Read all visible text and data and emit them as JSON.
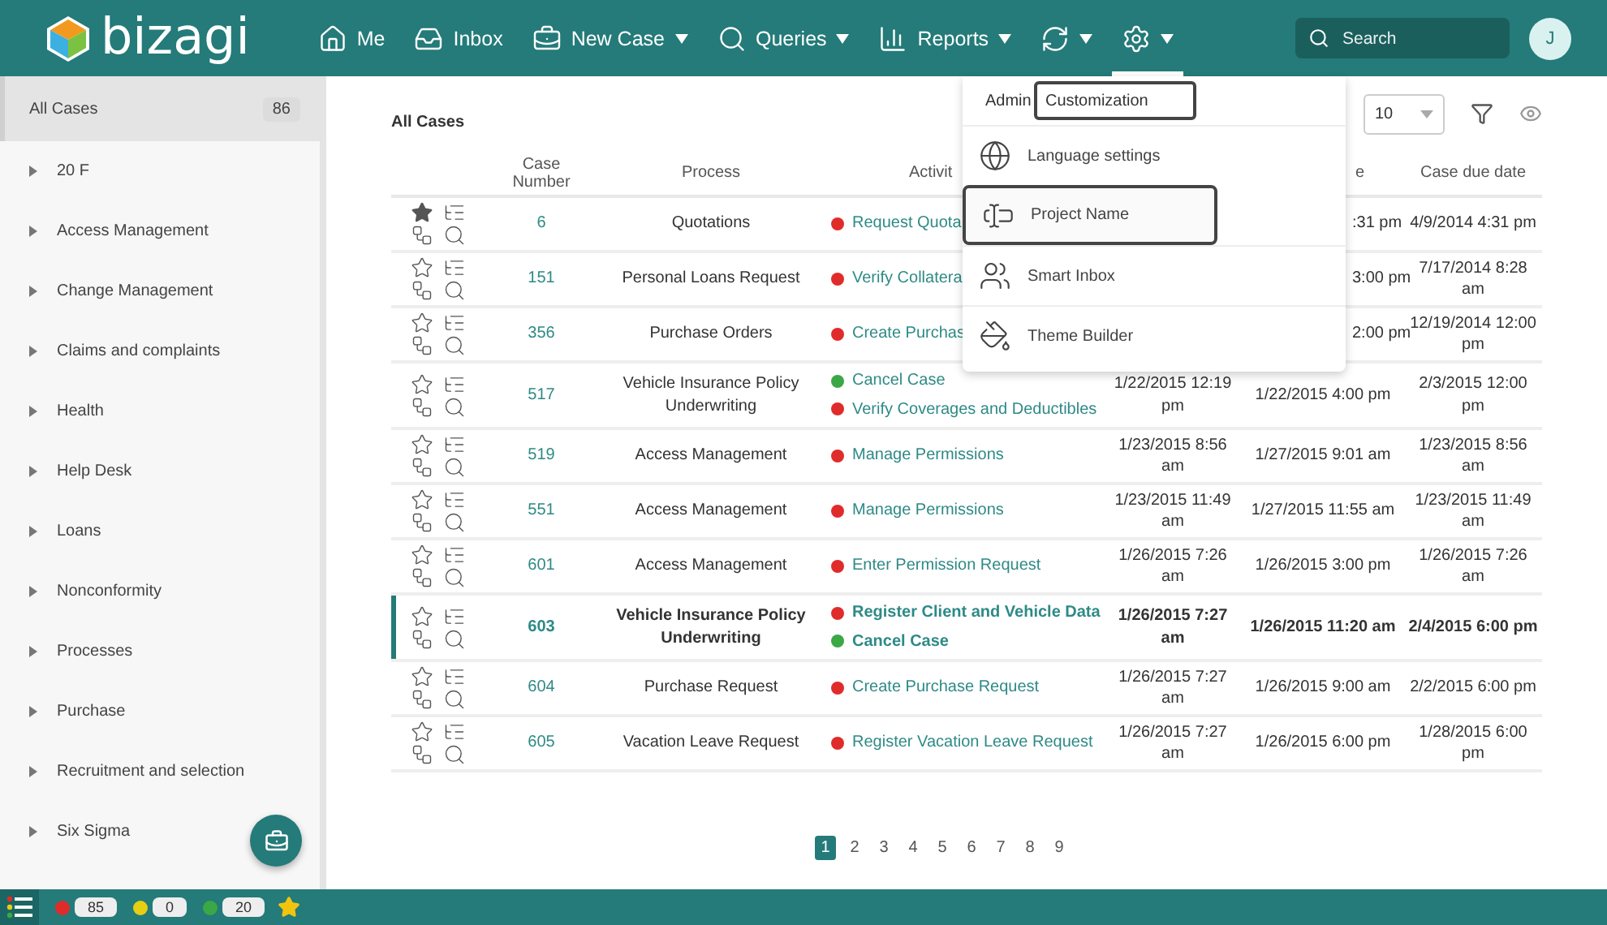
{
  "header": {
    "logo": "bizagi",
    "nav": [
      {
        "label": "Me",
        "dropdown": false,
        "selected": false
      },
      {
        "label": "Inbox",
        "dropdown": false,
        "selected": false
      },
      {
        "label": "New Case",
        "dropdown": true,
        "selected": false
      },
      {
        "label": "Queries",
        "dropdown": true,
        "selected": false
      },
      {
        "label": "Reports",
        "dropdown": true,
        "selected": false
      },
      {
        "dropdown": true,
        "selected": false
      },
      {
        "dropdown": true,
        "selected": true
      }
    ],
    "search": {
      "placeholder": "Search"
    },
    "avatar": "J"
  },
  "sidebar": {
    "items": [
      {
        "label": "All Cases",
        "count": "86",
        "selected": true
      },
      {
        "label": "20 F",
        "selected": false
      },
      {
        "label": "Access Management",
        "selected": false
      },
      {
        "label": "Change Management",
        "selected": false
      },
      {
        "label": "Claims and complaints",
        "selected": false
      },
      {
        "label": "Health",
        "selected": false
      },
      {
        "label": "Help Desk",
        "selected": false
      },
      {
        "label": "Loans",
        "selected": false
      },
      {
        "label": "Nonconformity",
        "selected": false
      },
      {
        "label": "Processes",
        "selected": false
      },
      {
        "label": "Purchase",
        "selected": false
      },
      {
        "label": "Recruitment and selection",
        "selected": false
      },
      {
        "label": "Six Sigma",
        "selected": false
      }
    ]
  },
  "content": {
    "title": "All Cases",
    "per_page": "10",
    "table": {
      "columns": [
        "",
        "Case Number",
        "Process",
        "Activit",
        "",
        "e",
        "Case due date"
      ],
      "rows": [
        {
          "favorite": true,
          "selected": false,
          "number": "6",
          "process": "Quotations",
          "activities": [
            {
              "label": "Request Quota",
              "color": "#e02b2b"
            }
          ],
          "column_4": "",
          "column_5": ":31 pm",
          "due": "4/9/2014 4:31 pm"
        },
        {
          "favorite": false,
          "selected": false,
          "number": "151",
          "process": "Personal Loans Request",
          "activities": [
            {
              "label": "Verify Collatera",
              "color": "#e02b2b"
            }
          ],
          "column_4": "",
          "column_5": "3:00 pm",
          "due": "7/17/2014 8:28 am"
        },
        {
          "favorite": false,
          "selected": false,
          "number": "356",
          "process": "Purchase Orders",
          "activities": [
            {
              "label": "Create Purchas",
              "color": "#e02b2b"
            }
          ],
          "column_4": "",
          "column_5": "2:00 pm",
          "due": "12/19/2014 12:00 pm"
        },
        {
          "favorite": false,
          "selected": false,
          "number": "517",
          "process": "Vehicle Insurance Policy Underwriting",
          "activities": [
            {
              "label": "Cancel Case",
              "color": "#3aa845"
            },
            {
              "label": "Verify Coverages and Deductibles",
              "color": "#e02b2b"
            }
          ],
          "column_4": "1/22/2015 12:19 pm",
          "column_5": "1/22/2015 4:00 pm",
          "due": "2/3/2015 12:00 pm"
        },
        {
          "favorite": false,
          "selected": false,
          "number": "519",
          "process": "Access Management",
          "activities": [
            {
              "label": "Manage Permissions",
              "color": "#e02b2b"
            }
          ],
          "column_4": "1/23/2015 8:56 am",
          "column_5": "1/27/2015 9:01 am",
          "due": "1/23/2015 8:56 am"
        },
        {
          "favorite": false,
          "selected": false,
          "number": "551",
          "process": "Access Management",
          "activities": [
            {
              "label": "Manage Permissions",
              "color": "#e02b2b"
            }
          ],
          "column_4": "1/23/2015 11:49 am",
          "column_5": "1/27/2015 11:55 am",
          "due": "1/23/2015 11:49 am"
        },
        {
          "favorite": false,
          "selected": false,
          "number": "601",
          "process": "Access Management",
          "activities": [
            {
              "label": "Enter Permission Request",
              "color": "#e02b2b"
            }
          ],
          "column_4": "1/26/2015 7:26 am",
          "column_5": "1/26/2015 3:00 pm",
          "due": "1/26/2015 7:26 am"
        },
        {
          "favorite": false,
          "selected": true,
          "number": "603",
          "process": "Vehicle Insurance Policy Underwriting",
          "activities": [
            {
              "label": "Register Client and Vehicle Data",
              "color": "#e02b2b"
            },
            {
              "label": "Cancel Case",
              "color": "#3aa845"
            }
          ],
          "column_4": "1/26/2015 7:27 am",
          "column_5": "1/26/2015 11:20 am",
          "due": "2/4/2015 6:00 pm"
        },
        {
          "favorite": false,
          "selected": false,
          "number": "604",
          "process": "Purchase Request",
          "activities": [
            {
              "label": "Create Purchase Request",
              "color": "#e02b2b"
            }
          ],
          "column_4": "1/26/2015 7:27 am",
          "column_5": "1/26/2015 9:00 am",
          "due": "2/2/2015 6:00 pm"
        },
        {
          "favorite": false,
          "selected": false,
          "number": "605",
          "process": "Vacation Leave Request",
          "activities": [
            {
              "label": "Register Vacation Leave Request",
              "color": "#e02b2b"
            }
          ],
          "column_4": "1/26/2015 7:27 am",
          "column_5": "1/26/2015 6:00 pm",
          "due": "1/28/2015 6:00 pm"
        }
      ]
    },
    "pagination": [
      {
        "label": "1",
        "selected": true
      },
      {
        "label": "2",
        "selected": false
      },
      {
        "label": "3",
        "selected": false
      },
      {
        "label": "4",
        "selected": false
      },
      {
        "label": "5",
        "selected": false
      },
      {
        "label": "6",
        "selected": false
      },
      {
        "label": "7",
        "selected": false
      },
      {
        "label": "8",
        "selected": false
      },
      {
        "label": "9",
        "selected": false
      }
    ]
  },
  "settings_menu": {
    "breadcrumb": "Admin",
    "current": "Customization",
    "items": [
      {
        "label": "Language settings",
        "selected": false
      },
      {
        "label": "Project Name",
        "selected": true
      },
      {
        "label": "Smart Inbox",
        "selected": false
      },
      {
        "label": "Theme Builder",
        "selected": false
      }
    ]
  },
  "status_bar": {
    "counters": [
      {
        "count": "85",
        "color": "#e02b2b"
      },
      {
        "count": "0",
        "color": "#e6cf12"
      },
      {
        "count": "20",
        "color": "#3aa845"
      }
    ]
  }
}
